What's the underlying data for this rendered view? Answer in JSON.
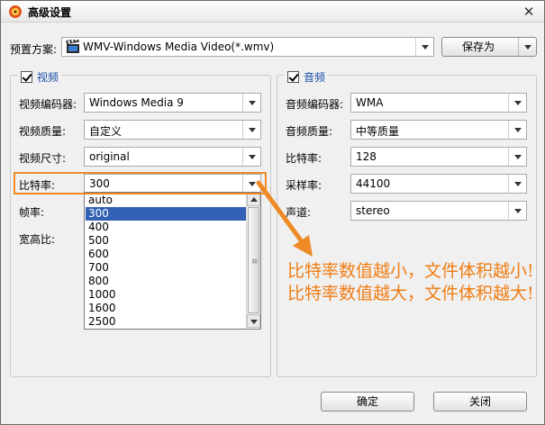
{
  "window": {
    "title": "高级设置",
    "close_label": "✕"
  },
  "preset": {
    "label": "预置方案:",
    "value": "WMV-Windows Media Video(*.wmv)",
    "save_as_label": "保存为"
  },
  "video": {
    "group_title": "视频",
    "checked": true,
    "encoder_label": "视频编码器:",
    "encoder_value": "Windows Media 9",
    "quality_label": "视频质量:",
    "quality_value": "自定义",
    "size_label": "视频尺寸:",
    "size_value": "original",
    "bitrate_label": "比特率:",
    "bitrate_value": "300",
    "framerate_label": "帧率:",
    "aspect_label": "宽高比:",
    "bitrate_options": [
      "auto",
      "300",
      "400",
      "500",
      "600",
      "700",
      "800",
      "1000",
      "1600",
      "2500"
    ],
    "bitrate_selected": "300"
  },
  "audio": {
    "group_title": "音频",
    "checked": true,
    "encoder_label": "音频编码器:",
    "encoder_value": "WMA",
    "quality_label": "音频质量:",
    "quality_value": "中等质量",
    "bitrate_label": "比特率:",
    "bitrate_value": "128",
    "samplerate_label": "采样率:",
    "samplerate_value": "44100",
    "channel_label": "声道:",
    "channel_value": "stereo"
  },
  "annotation": {
    "line1": "比特率数值越小，文件体积越小!",
    "line2": "比特率数值越大，文件体积越大!",
    "color": "#f07d14"
  },
  "footer": {
    "ok_label": "确定",
    "close_label": "关闭"
  }
}
